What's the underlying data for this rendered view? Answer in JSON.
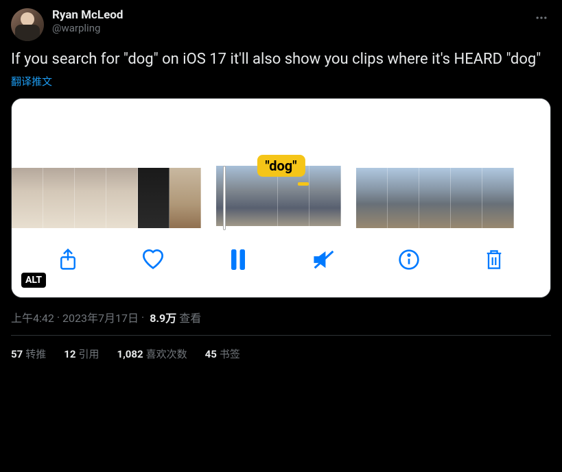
{
  "author": {
    "display_name": "Ryan McLeod",
    "handle": "@warpling"
  },
  "tweet_text": "If you search for \"dog\" on iOS 17 it'll also show you clips where it's HEARD \"dog\"",
  "translate_label": "翻译推文",
  "media": {
    "search_term": "\"dog\"",
    "alt_badge": "ALT",
    "toolbar_icons": {
      "share": "share-icon",
      "like": "heart-icon",
      "pause": "pause-icon",
      "mute": "mute-icon",
      "info": "info-icon",
      "trash": "trash-icon"
    }
  },
  "meta": {
    "time": "上午4:42",
    "date": "2023年7月17日",
    "views_count": "8.9万",
    "views_label": "查看"
  },
  "stats": {
    "retweets": {
      "count": "57",
      "label": "转推"
    },
    "quotes": {
      "count": "12",
      "label": "引用"
    },
    "likes": {
      "count": "1,082",
      "label": "喜欢次数"
    },
    "bookmarks": {
      "count": "45",
      "label": "书签"
    }
  }
}
